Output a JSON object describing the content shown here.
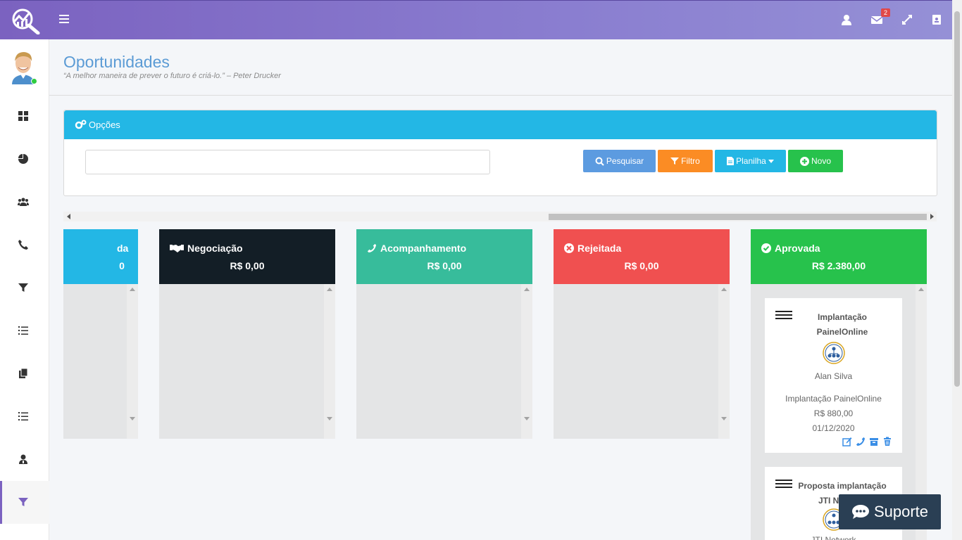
{
  "topbar": {
    "mail_badge": "2",
    "icons": [
      "user-icon",
      "envelope-icon",
      "expand-icon",
      "address-book-icon"
    ]
  },
  "sidebar": {
    "icons": [
      "dashboard-icon",
      "pie-chart-icon",
      "users-icon",
      "phone-icon",
      "filter-icon",
      "list-ol-icon",
      "files-icon",
      "list-icon",
      "user-tie-icon",
      "funnel-icon"
    ],
    "active_index": 9
  },
  "header": {
    "title": "Oportunidades",
    "quote": "“A melhor maneira de prever o futuro é criá-lo.” – Peter Drucker"
  },
  "options": {
    "title": "Opções",
    "search_value": "",
    "buttons": {
      "pesquisar": "Pesquisar",
      "filtro": "Filtro",
      "planilha": "Planilha",
      "novo": "Novo"
    }
  },
  "kanban": {
    "columns": [
      {
        "title": "da",
        "value": "0",
        "color": "#23b7e5"
      },
      {
        "title": "Negociação",
        "value": "R$ 0,00",
        "color": "#131e26",
        "icon": "handshake-icon"
      },
      {
        "title": "Acompanhamento",
        "value": "R$ 0,00",
        "color": "#37bc9b",
        "icon": "phone-icon"
      },
      {
        "title": "Rejeitada",
        "value": "R$ 0,00",
        "color": "#f05050",
        "icon": "times-circle-icon"
      },
      {
        "title": "Aprovada",
        "value": "R$ 2.380,00",
        "color": "#27c24c",
        "icon": "check-circle-icon"
      }
    ],
    "cards": [
      {
        "title": "Implantação PainelOnline",
        "owner": "Alan Silva",
        "description": "Implantação PainelOnline",
        "value": "R$ 880,00",
        "date": "01/12/2020"
      },
      {
        "title": "Proposta implantação JTI Network",
        "owner": "JTI Network"
      }
    ]
  },
  "support": {
    "label": "Suporte"
  }
}
